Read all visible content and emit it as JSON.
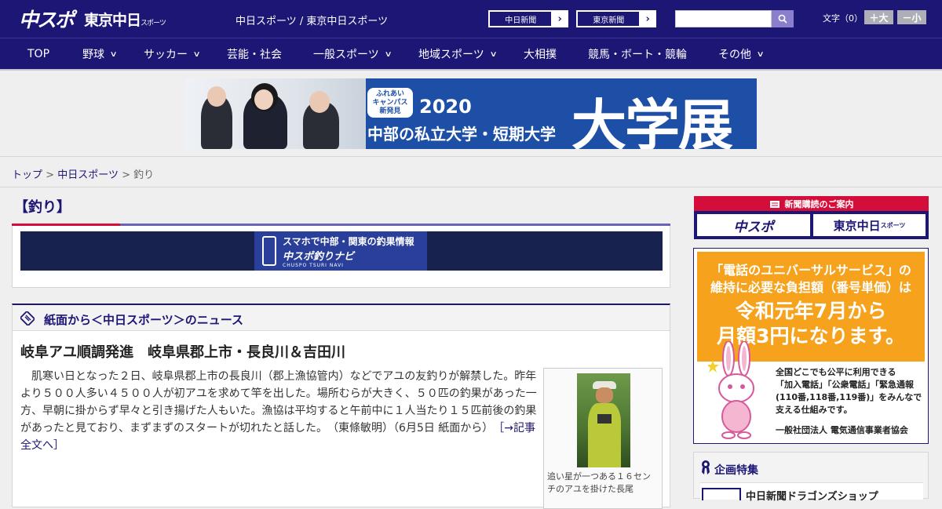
{
  "header": {
    "logo_primary": "中スポ",
    "logo_secondary": "東京中日",
    "logo_secondary_small": "スポーツ",
    "site_name": "中日スポーツ / 東京中日スポーツ",
    "ext_links": [
      {
        "label": "中日新聞"
      },
      {
        "label": "東京新聞"
      }
    ],
    "search": {
      "placeholder": "",
      "value": ""
    },
    "fontsize": {
      "label": "文字（0）",
      "larger": "＋大",
      "smaller": "－小"
    }
  },
  "nav": {
    "items": [
      {
        "label": "TOP",
        "has_menu": false
      },
      {
        "label": "野球",
        "has_menu": true
      },
      {
        "label": "サッカー",
        "has_menu": true
      },
      {
        "label": "芸能・社会",
        "has_menu": false
      },
      {
        "label": "一般スポーツ",
        "has_menu": true
      },
      {
        "label": "地域スポーツ",
        "has_menu": true
      },
      {
        "label": "大相撲",
        "has_menu": false
      },
      {
        "label": "競馬・ボート・競輪",
        "has_menu": false
      },
      {
        "label": "その他",
        "has_menu": true
      }
    ]
  },
  "banner": {
    "badge_line1": "ふれあい",
    "badge_line2": "キャンパス",
    "badge_line3": "新発見",
    "year": "2020",
    "subtitle": "中部の私立大学・短期大学",
    "big": "大学展"
  },
  "breadcrumb": {
    "items": [
      {
        "label": "トップ",
        "link": true
      },
      {
        "label": "中日スポーツ",
        "link": true
      },
      {
        "label": "釣り",
        "link": false
      }
    ],
    "separator": ">"
  },
  "category": {
    "title": "【釣り】"
  },
  "navi_banner": {
    "line1": "スマホで中部・関東の釣果情報",
    "line2": "中スポ釣りナビ",
    "line3": "CHUSPO TSURI NAVI"
  },
  "news": {
    "section_title": "紙面から＜中日スポーツ＞のニュース",
    "headline": "岐阜アユ順調発進　岐阜県郡上市・長良川＆吉田川",
    "body": "肌寒い日となった２日、岐阜県郡上市の長良川（郡上漁協管内）などでアユの友釣りが解禁した。昨年より５００人多い４５００人が初アユを求めて竿を出した。場所むらが大きく、５０匹の釣果があった一方、早朝に掛からず早々と引き揚げた人もいた。漁協は平均すると午前中に１人当たり１５匹前後の釣果があったと見ており、まずまずのスタートが切れたと話した。",
    "byline": "（東條敏明）（6月5日 紙面から）",
    "more_link": "［→記事全文へ］",
    "photo_caption": "追い星が一つある１６センチのアユを掛けた長尾"
  },
  "sidebar": {
    "subscription": {
      "header": "新聞購読のご案内",
      "logo_left": "中スポ",
      "logo_right": "東京中日",
      "logo_right_small": "スポーツ"
    },
    "ad": {
      "line1": "「電話のユニバーサルサービス」の",
      "line2": "維持に必要な負担額（番号単価）は",
      "line3": "令和元年7月から",
      "line4": "月額3円になります。",
      "body1": "全国どこでも公平に利用できる",
      "body2": "「加入電話」「公衆電話」「緊急通報",
      "body3": "(110番,118番,119番)」をみんなで",
      "body4": "支える仕組みです。",
      "sponsor": "一般社団法人 電気通信事業者協会"
    },
    "special": {
      "title": "企画特集",
      "first_item": "中日新聞ドラゴンズショップ"
    }
  },
  "colors": {
    "brand_navy": "#1c1675",
    "accent_red": "#d40d3a",
    "ad_orange": "#f6a21d",
    "banner_blue": "#1e4fa6"
  }
}
